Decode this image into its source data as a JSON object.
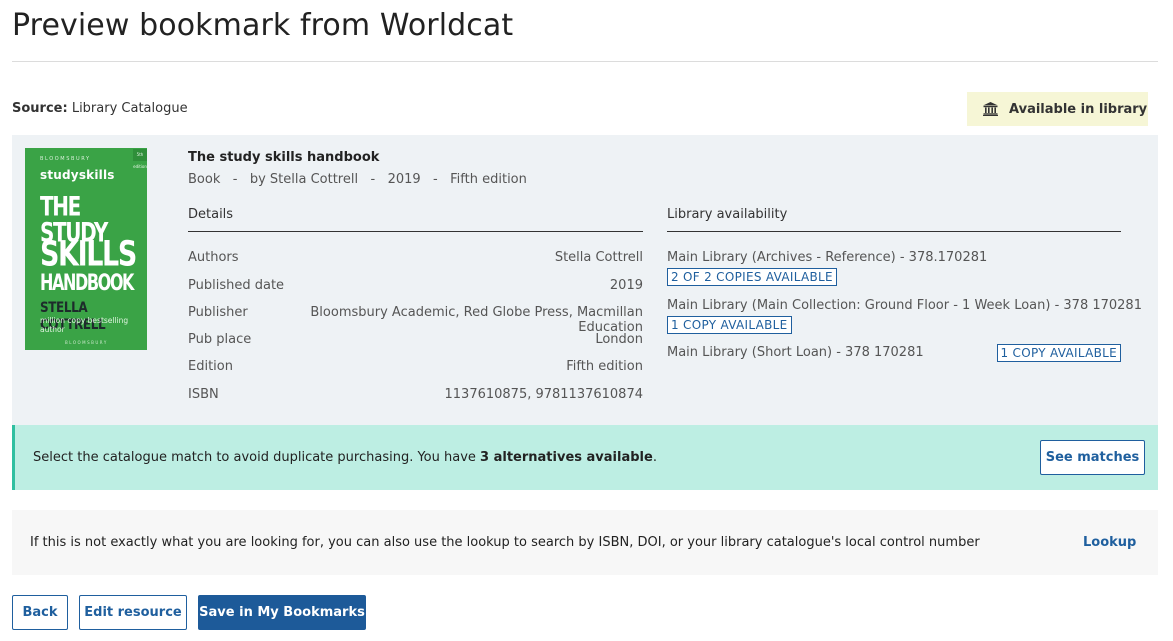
{
  "page": {
    "title": "Preview bookmark from Worldcat"
  },
  "source": {
    "label": "Source:",
    "value": "Library Catalogue"
  },
  "availability_badge": {
    "label": "Available in library",
    "icon": "library-building-icon",
    "bg_color": "#f6f6d6"
  },
  "resource": {
    "title": "The study skills handbook",
    "meta": "Book   -   by Stella Cottrell   -   2019   -   Fifth edition",
    "cover": {
      "publisher_line": "BLOOMSBURY",
      "edition_badge": "5th edition",
      "series": "studyskills",
      "title_lines": [
        "THE STUDY",
        "SKILLS",
        "HANDBOOK"
      ],
      "author": "STELLA COTTRELL",
      "tagline": "million copy bestselling author",
      "bottom_line": "BLOOMSBURY",
      "color": "#3aa346"
    }
  },
  "details": {
    "heading": "Details",
    "rows": [
      {
        "label": "Authors",
        "value": "Stella Cottrell"
      },
      {
        "label": "Published date",
        "value": "2019"
      },
      {
        "label": "Publisher",
        "value": "Bloomsbury Academic, Red Globe Press, Macmillan Education"
      },
      {
        "label": "Pub place",
        "value": "London"
      },
      {
        "label": "Edition",
        "value": "Fifth edition"
      },
      {
        "label": "ISBN",
        "value": "1137610875, 9781137610874"
      }
    ]
  },
  "library": {
    "heading": "Library availability",
    "entries": [
      {
        "location": "Main Library (Archives - Reference) - 378.170281",
        "copies": "2 OF 2 COPIES AVAILABLE"
      },
      {
        "location": "Main Library (Main Collection: Ground Floor - 1 Week Loan) - 378 170281",
        "copies": "1 COPY AVAILABLE"
      },
      {
        "location": "Main Library (Short Loan) - 378 170281",
        "copies": "1 COPY AVAILABLE"
      }
    ]
  },
  "match_banner": {
    "text_before": "Select the catalogue match to avoid duplicate purchasing. You have ",
    "text_bold": "3 alternatives available",
    "text_after": ".",
    "button": "See matches",
    "bg_color": "#bdeee3"
  },
  "lookup": {
    "text": "If this is not exactly what you are looking for, you can also use the lookup to search by ISBN, DOI, or your library catalogue's local control number",
    "link": "Lookup"
  },
  "actions": {
    "back": "Back",
    "edit": "Edit resource",
    "save": "Save in My Bookmarks"
  },
  "colors": {
    "accent": "#1f5f9e",
    "primary_button": "#1d5a99",
    "panel_bg": "#eef2f5"
  }
}
